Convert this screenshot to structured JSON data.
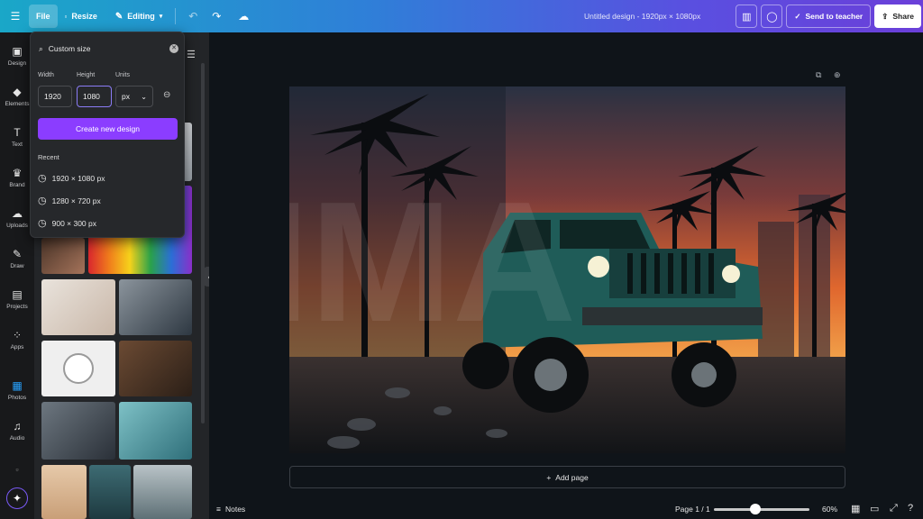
{
  "topbar": {
    "file_label": "File",
    "resize_label": "Resize",
    "editing_label": "Editing",
    "doc_title": "Untitled design - 1920px × 1080px",
    "send_teacher_label": "Send to teacher",
    "share_label": "Share"
  },
  "rail": {
    "items": [
      {
        "label": "Design",
        "icon": "design-icon"
      },
      {
        "label": "Elements",
        "icon": "elements-icon"
      },
      {
        "label": "Text",
        "icon": "text-icon"
      },
      {
        "label": "Brand",
        "icon": "brand-icon"
      },
      {
        "label": "Uploads",
        "icon": "uploads-icon"
      },
      {
        "label": "Draw",
        "icon": "draw-icon"
      },
      {
        "label": "Projects",
        "icon": "projects-icon"
      },
      {
        "label": "Apps",
        "icon": "apps-icon"
      },
      {
        "label": "Photos",
        "icon": "photos-icon"
      },
      {
        "label": "Audio",
        "icon": "audio-icon"
      }
    ]
  },
  "dropdown": {
    "search_value": "Custom size",
    "width_label": "Width",
    "height_label": "Height",
    "units_label": "Units",
    "width_value": "1920",
    "height_value": "1080",
    "units_value": "px",
    "create_label": "Create new design",
    "recent_label": "Recent",
    "recent": [
      "1920 × 1080 px",
      "1280 × 720 px",
      "900 × 300 px"
    ]
  },
  "canvas": {
    "add_page_label": "Add page"
  },
  "bottombar": {
    "notes_label": "Notes",
    "page_label": "Page 1 / 1",
    "zoom_label": "60%",
    "zoom_level": 0.6
  },
  "colors": {
    "accent": "#8b3dff",
    "active": "#27a2ff"
  }
}
